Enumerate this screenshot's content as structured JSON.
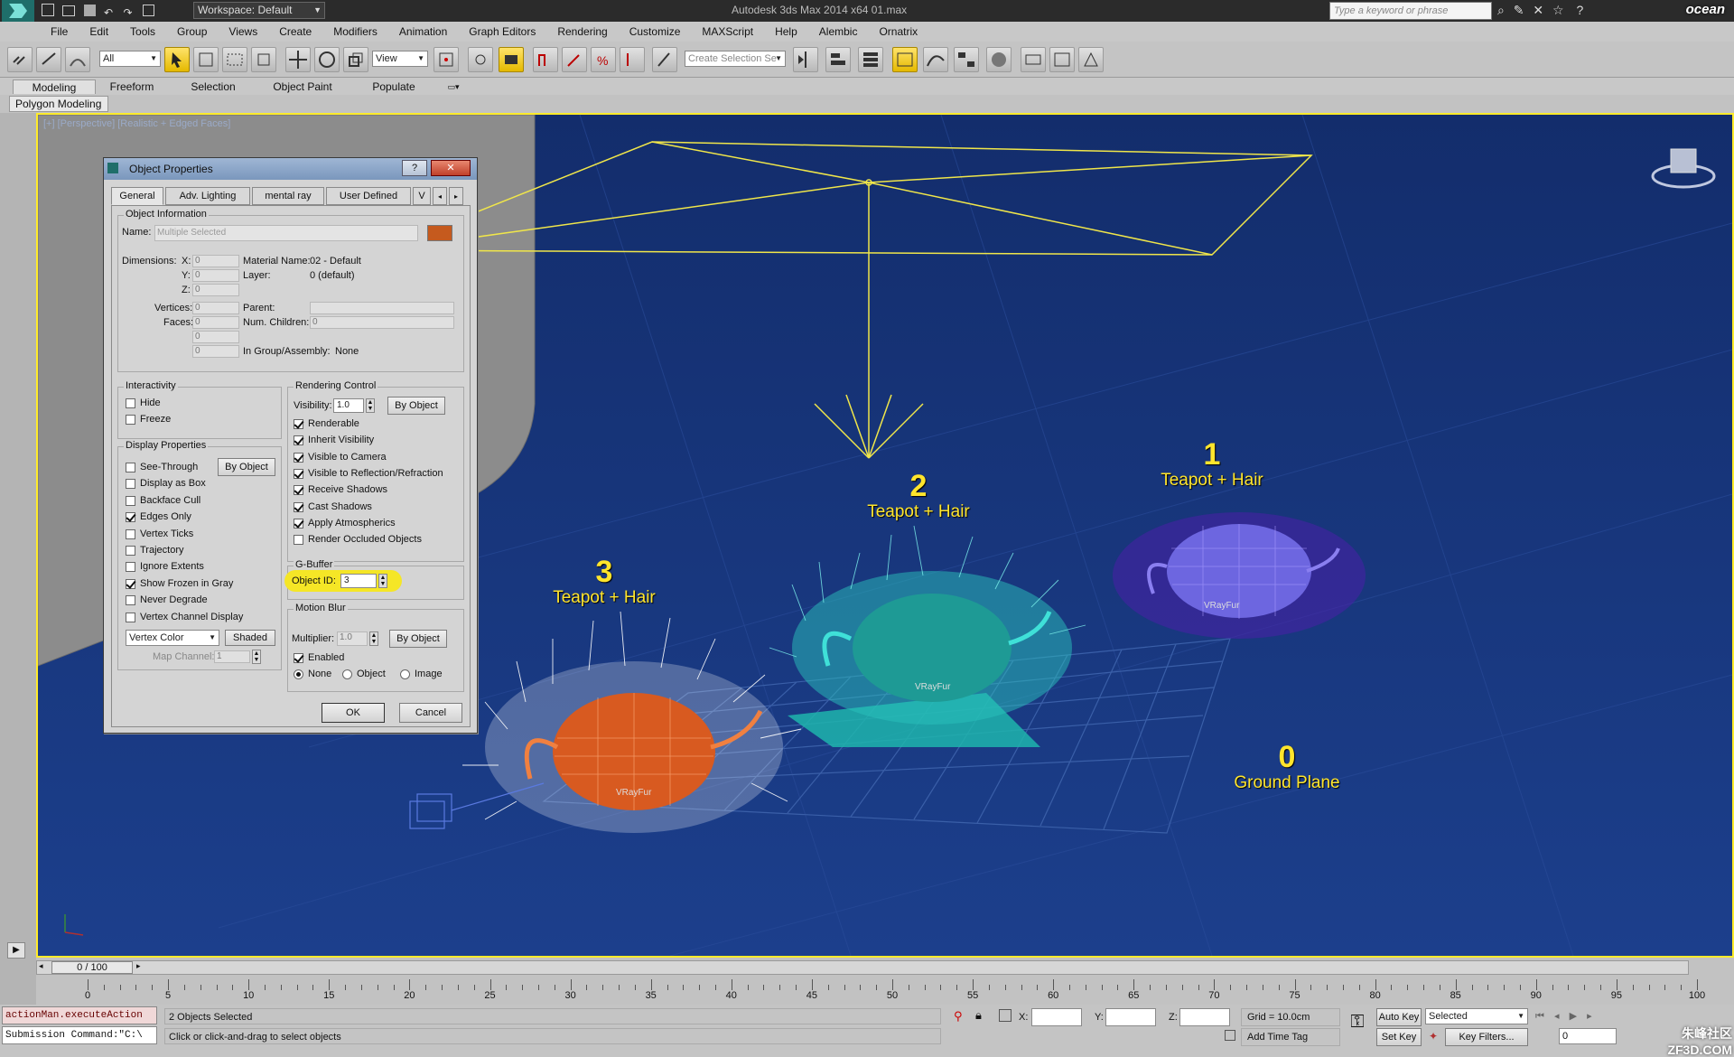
{
  "app": {
    "title": "Autodesk 3ds Max  2014 x64     01.max",
    "workspace_label": "Workspace: Default",
    "search_placeholder": "Type a keyword or phrase",
    "brand_logo_text": "ocean",
    "watermark_text": "朱峰社区 ZF3D.COM"
  },
  "menu": [
    "File",
    "Edit",
    "Tools",
    "Group",
    "Views",
    "Create",
    "Modifiers",
    "Animation",
    "Graph Editors",
    "Rendering",
    "Customize",
    "MAXScript",
    "Help",
    "Alembic",
    "Ornatrix"
  ],
  "toolbar": {
    "filter_value": "All",
    "refcoord_value": "View",
    "selection_set_placeholder": "Create Selection Se"
  },
  "ribbon": {
    "tabs": [
      "Modeling",
      "Freeform",
      "Selection",
      "Object Paint",
      "Populate"
    ],
    "sub_label": "Polygon Modeling"
  },
  "viewport": {
    "label": "[+] [Perspective] [Realistic + Edged Faces]",
    "objects": [
      {
        "number": "1",
        "label": "Teapot + Hair",
        "color": "#7a5ad8"
      },
      {
        "number": "2",
        "label": "Teapot + Hair",
        "color": "#2ec7c2"
      },
      {
        "number": "3",
        "label": "Teapot + Hair",
        "color": "#e0601c"
      },
      {
        "number": "0",
        "label": "Ground Plane",
        "color": "#2c4ea8"
      }
    ],
    "fur_label": "VRayFur"
  },
  "dialog": {
    "title": "Object Properties",
    "help_btn": "?",
    "close_btn": "✕",
    "tabs": [
      "General",
      "Adv. Lighting",
      "mental ray",
      "User Defined",
      "V"
    ],
    "object_info": {
      "group_title": "Object Information",
      "name_label": "Name:",
      "name_value": "Multiple Selected",
      "swatch_color": "#c55a1e",
      "dimensions_label": "Dimensions:",
      "x_label": "X:",
      "y_label": "Y:",
      "z_label": "Z:",
      "dim_value": "0",
      "material_label": "Material Name:",
      "material_value": "02 - Default",
      "layer_label": "Layer:",
      "layer_value": "0 (default)",
      "vertices_label": "Vertices:",
      "faces_label": "Faces:",
      "parent_label": "Parent:",
      "children_label": "Num. Children:",
      "children_value": "0",
      "group_label": "In Group/Assembly:",
      "group_value": "None"
    },
    "interactivity": {
      "title": "Interactivity",
      "hide": "Hide",
      "freeze": "Freeze"
    },
    "display": {
      "title": "Display Properties",
      "by_object": "By Object",
      "items": [
        {
          "label": "See-Through",
          "checked": false
        },
        {
          "label": "Display as Box",
          "checked": false
        },
        {
          "label": "Backface Cull",
          "checked": false
        },
        {
          "label": "Edges Only",
          "checked": true
        },
        {
          "label": "Vertex Ticks",
          "checked": false
        },
        {
          "label": "Trajectory",
          "checked": false
        },
        {
          "label": "Ignore Extents",
          "checked": false
        },
        {
          "label": "Show Frozen in Gray",
          "checked": true
        },
        {
          "label": "Never Degrade",
          "checked": false
        },
        {
          "label": "Vertex Channel Display",
          "checked": false
        }
      ],
      "vertex_color_value": "Vertex Color",
      "shaded_btn": "Shaded",
      "map_channel_label": "Map Channel:",
      "map_channel_value": "1"
    },
    "rendering": {
      "title": "Rendering Control",
      "visibility_label": "Visibility:",
      "visibility_value": "1.0",
      "by_object": "By Object",
      "items": [
        {
          "label": "Renderable",
          "checked": true
        },
        {
          "label": "Inherit Visibility",
          "checked": true
        },
        {
          "label": "Visible to Camera",
          "checked": true
        },
        {
          "label": "Visible to Reflection/Refraction",
          "checked": true
        },
        {
          "label": "Receive Shadows",
          "checked": true
        },
        {
          "label": "Cast Shadows",
          "checked": true
        },
        {
          "label": "Apply Atmospherics",
          "checked": true
        },
        {
          "label": "Render Occluded Objects",
          "checked": false
        }
      ]
    },
    "gbuffer": {
      "title": "G-Buffer",
      "object_id_label": "Object ID:",
      "object_id_value": "3"
    },
    "motion_blur": {
      "title": "Motion Blur",
      "multiplier_label": "Multiplier:",
      "multiplier_value": "1.0",
      "by_object": "By Object",
      "enabled_label": "Enabled",
      "radios": [
        "None",
        "Object",
        "Image"
      ]
    },
    "ok": "OK",
    "cancel": "Cancel"
  },
  "timeline": {
    "frame_display": "0 / 100",
    "ticks": [
      "0",
      "5",
      "10",
      "15",
      "20",
      "25",
      "30",
      "35",
      "40",
      "45",
      "50",
      "55",
      "60",
      "65",
      "70",
      "75",
      "80",
      "85",
      "90",
      "95",
      "100"
    ]
  },
  "status": {
    "maxscript_line1": "actionMan.executeAction",
    "maxscript_line2": "Submission Command:\"C:\\",
    "selected_text": "2 Objects Selected",
    "prompt_text": "Click or click-and-drag to select objects",
    "x_label": "X:",
    "y_label": "Y:",
    "z_label": "Z:",
    "grid_text": "Grid = 10.0cm",
    "add_time_tag": "Add Time Tag",
    "auto_key": "Auto Key",
    "set_key": "Set Key",
    "selected_dropdown": "Selected",
    "key_filters": "Key Filters...",
    "frame_value": "0"
  }
}
